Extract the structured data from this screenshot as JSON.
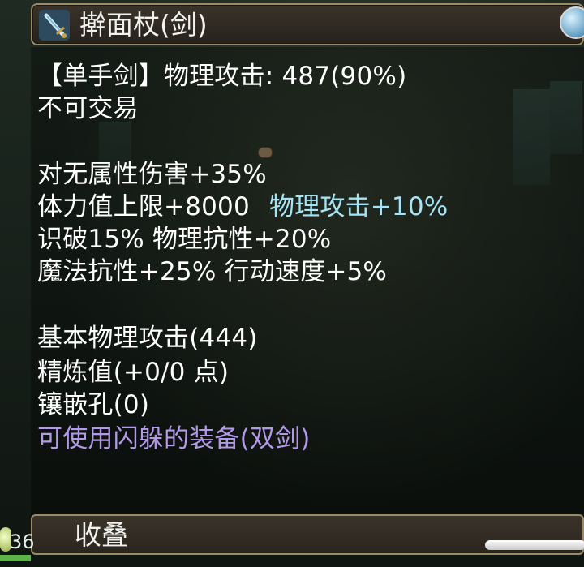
{
  "title": {
    "item_name": "擀面杖(剑)"
  },
  "lines": {
    "type_and_attack": "【单手剑】物理攻击: 487(90%)",
    "trade": "不可交易",
    "attr1": "对无属性伤害+35%",
    "attr2a": "体力值上限+8000",
    "attr2b": "物理攻击+10%",
    "attr3": "识破15% 物理抗性+20%",
    "attr4": "魔法抗性+25% 行动速度+5%",
    "base_attack": "基本物理攻击(444)",
    "refine": "精炼值(+0/0 点)",
    "socket": "镶嵌孔(0)",
    "equip_note": "可使用闪躲的装备(双剑)"
  },
  "footer": {
    "collapse_label": "收叠"
  },
  "hud": {
    "level_text": "36"
  },
  "colors": {
    "text": "#ffffff",
    "bonus_cyan": "#a6e4f5",
    "special_purple": "#b39ae8",
    "frame_gold": "#9a8a66"
  },
  "icons": {
    "item": "sword-icon",
    "corner": "globe-icon"
  }
}
